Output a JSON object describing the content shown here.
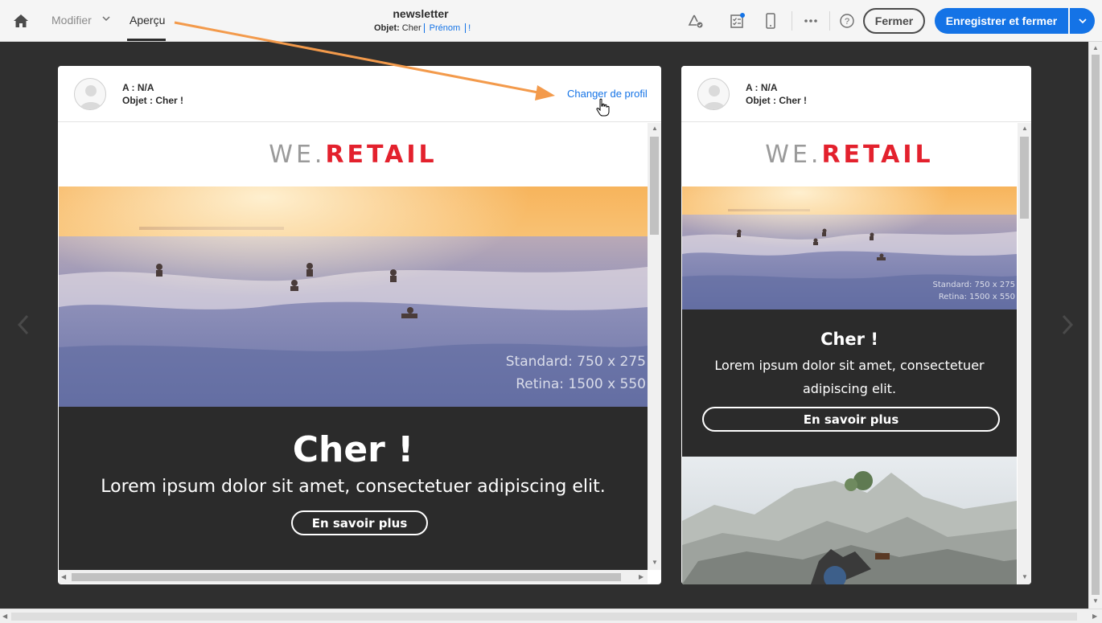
{
  "topbar": {
    "nav": {
      "modifier": "Modifier",
      "apercu": "Aperçu"
    },
    "document": {
      "title": "newsletter",
      "subject_label": "Objet:",
      "subject_prefix": "Cher",
      "subject_token": "Prénom",
      "subject_suffix": "!"
    },
    "icons": [
      "home-icon",
      "chevron-down-icon",
      "preflight-icon",
      "checklist-icon",
      "mobile-icon",
      "more-icon",
      "help-icon"
    ],
    "buttons": {
      "close": "Fermer",
      "save_close": "Enregistrer et fermer"
    }
  },
  "cards": [
    {
      "header": {
        "to": "A : N/A",
        "subject": "Objet : Cher !",
        "change_profile": "Changer de profil"
      },
      "email": {
        "logo_we": "WE.",
        "logo_retail": "RETAIL",
        "hero_dims_standard": "Standard: 750 x 275",
        "hero_dims_retina": "Retina: 1500 x 550",
        "title": "Cher  !",
        "body": "Lorem ipsum dolor sit amet, consectetuer adipiscing elit.",
        "cta": "En savoir plus"
      }
    },
    {
      "header": {
        "to": "A : N/A",
        "subject": "Objet : Cher !"
      },
      "email": {
        "logo_we": "WE.",
        "logo_retail": "RETAIL",
        "hero_dims_standard": "Standard: 750 x 275",
        "hero_dims_retina": "Retina: 1500 x 550",
        "title": "Cher  !",
        "body": "Lorem ipsum dolor sit amet, consectetuer adipiscing elit.",
        "cta": "En savoir plus"
      }
    }
  ],
  "colors": {
    "accent": "#1473e6",
    "annotation": "#f39a4b",
    "brand_red": "#e3212d",
    "dark_bg": "#2f2f2f"
  }
}
